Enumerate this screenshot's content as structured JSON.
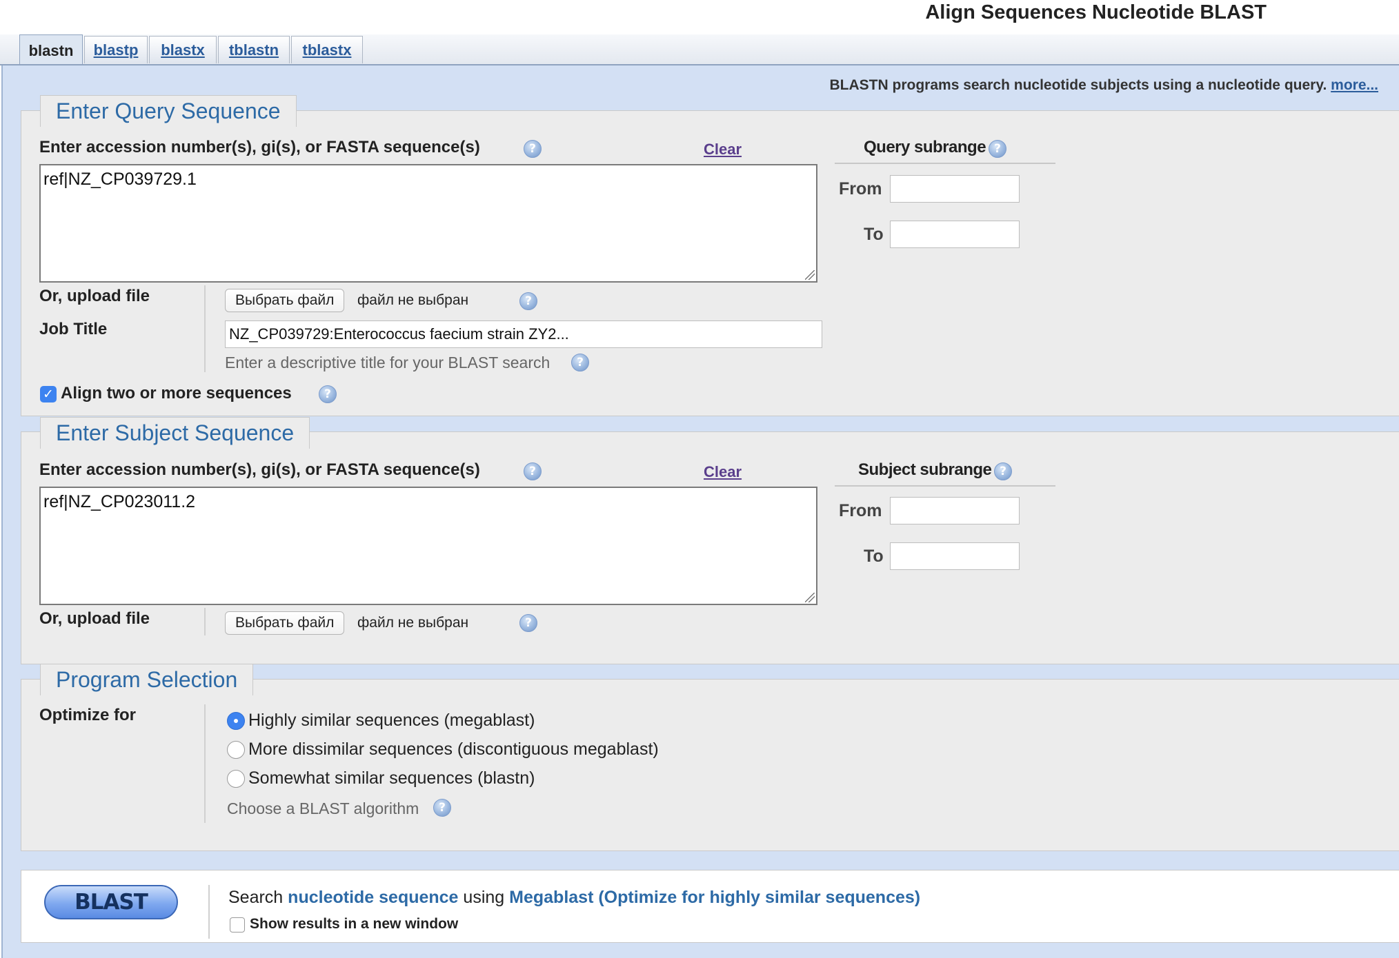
{
  "page": {
    "title": "Align Sequences Nucleotide BLAST"
  },
  "tabs": [
    {
      "label": "blastn",
      "active": true
    },
    {
      "label": "blastp",
      "active": false
    },
    {
      "label": "blastx",
      "active": false
    },
    {
      "label": "tblastn",
      "active": false
    },
    {
      "label": "tblastx",
      "active": false
    }
  ],
  "info": {
    "text": "BLASTN programs search nucleotide subjects using a nucleotide query.",
    "more_link": "more..."
  },
  "query": {
    "legend": "Enter Query Sequence",
    "input_label": "Enter accession number(s), gi(s), or FASTA sequence(s)",
    "clear_label": "Clear",
    "sequence_value": "ref|NZ_CP039729.1",
    "subrange_title": "Query subrange",
    "from_label": "From",
    "to_label": "To",
    "upload_label": "Or, upload file",
    "file_button": "Выбрать файл",
    "file_status": "файл не выбран",
    "job_title_label": "Job Title",
    "job_title_value": "NZ_CP039729:Enterococcus faecium strain ZY2...",
    "job_title_hint": "Enter a descriptive title for your BLAST search",
    "align_two_label": "Align two or more sequences",
    "align_two_checked": true
  },
  "subject": {
    "legend": "Enter Subject Sequence",
    "input_label": "Enter accession number(s), gi(s), or FASTA sequence(s)",
    "clear_label": "Clear",
    "sequence_value": "ref|NZ_CP023011.2",
    "subrange_title": "Subject subrange",
    "from_label": "From",
    "to_label": "To",
    "upload_label": "Or, upload file",
    "file_button": "Выбрать файл",
    "file_status": "файл не выбран"
  },
  "program": {
    "legend": "Program Selection",
    "optimize_label": "Optimize for",
    "options": [
      {
        "label": "Highly similar sequences (megablast)",
        "selected": true
      },
      {
        "label": "More dissimilar sequences (discontiguous megablast)",
        "selected": false
      },
      {
        "label": "Somewhat similar sequences (blastn)",
        "selected": false
      }
    ],
    "hint": "Choose a BLAST algorithm"
  },
  "submit": {
    "button_label": "BLAST",
    "search_prefix": "Search",
    "search_target": "nucleotide sequence",
    "search_middle": "using",
    "search_algorithm": "Megablast (Optimize for highly similar sequences)",
    "new_window_label": "Show results in a new window",
    "new_window_checked": false
  },
  "colors": {
    "accent": "#2d6aa6",
    "background": "#d3e0f4",
    "panel": "#ececec",
    "checkbox": "#3d83f0"
  },
  "icons": {
    "help": "help-question-icon"
  }
}
